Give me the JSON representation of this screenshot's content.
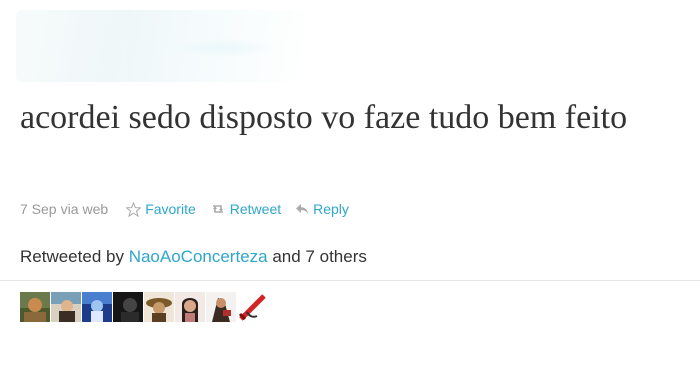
{
  "tweet": {
    "text": "acordei sedo disposto vo faze tudo bem feito"
  },
  "meta": {
    "date": "7 Sep",
    "via": "via",
    "source": "web"
  },
  "actions": {
    "favorite": "Favorite",
    "retweet": "Retweet",
    "reply": "Reply"
  },
  "retweets": {
    "prefix": "Retweeted by",
    "user": "NaoAoConcerteza",
    "suffix": "and 7 others"
  },
  "colors": {
    "link": "#2fa6cc",
    "muted": "#999999",
    "text": "#333333"
  },
  "avatars": [
    {
      "name": "avatar-1"
    },
    {
      "name": "avatar-2"
    },
    {
      "name": "avatar-3"
    },
    {
      "name": "avatar-4"
    },
    {
      "name": "avatar-5"
    },
    {
      "name": "avatar-6"
    },
    {
      "name": "avatar-7"
    },
    {
      "name": "avatar-8"
    }
  ]
}
